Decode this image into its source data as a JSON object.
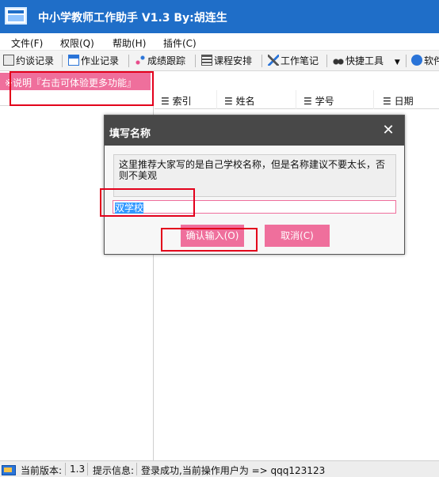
{
  "window": {
    "title": "中小学教师工作助手 V1.3  By:胡连生"
  },
  "menu": [
    "文件(F)",
    "权限(Q)",
    "帮助(H)",
    "插件(C)"
  ],
  "toolbar": [
    "约谈记录",
    "作业记录",
    "成绩跟踪",
    "课程安排",
    "工作笔记",
    "快捷工具",
    "软件"
  ],
  "left_panel": {
    "banner": "※说明『右击可体验更多功能』"
  },
  "grid": {
    "columns": [
      "索引",
      "姓名",
      "学号",
      "日期"
    ]
  },
  "dialog": {
    "title": "填写名称",
    "message": "这里推荐大家写的是自己学校名称，但是名称建议不要太长，否则不美观",
    "input_value": "双学校",
    "confirm_label": "确认输入(O)",
    "cancel_label": "取消(C)"
  },
  "status": {
    "version_label": "当前版本:",
    "version": "1.3",
    "info_label": "提示信息:",
    "info": "登录成功,当前操作用户为 => qqq123123"
  },
  "colors": {
    "accent_pink": "#ef6f9c",
    "title_blue": "#1f6ec8",
    "dialog_header": "#484848",
    "highlight_red": "#e3001b"
  }
}
